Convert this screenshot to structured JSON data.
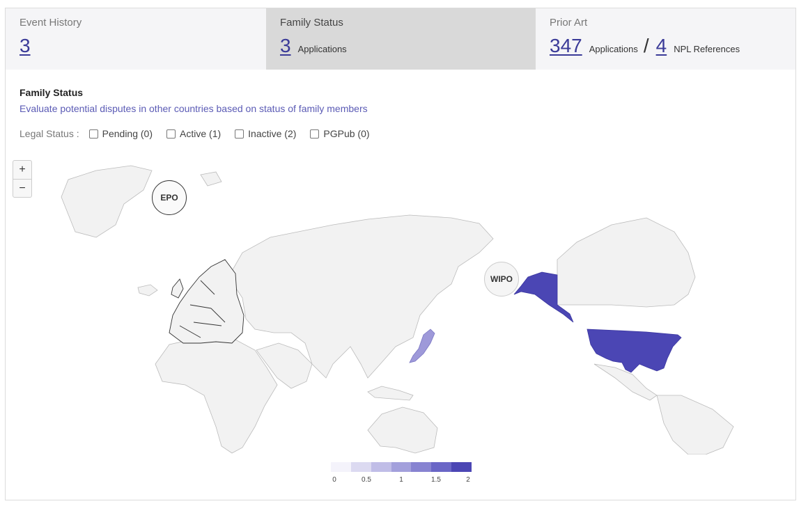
{
  "tabs": [
    {
      "title": "Event History",
      "value": "3",
      "unit": ""
    },
    {
      "title": "Family Status",
      "value": "3",
      "unit": "Applications"
    },
    {
      "title": "Prior Art",
      "value": "347",
      "unit": "Applications",
      "separator": "/",
      "value2": "4",
      "unit2": "NPL References"
    }
  ],
  "section": {
    "title": "Family Status",
    "subtitle": "Evaluate potential disputes in other countries based on status of family members"
  },
  "legal_status": {
    "label": "Legal Status :",
    "options": [
      "Pending (0)",
      "Active (1)",
      "Inactive (2)",
      "PGPub (0)"
    ]
  },
  "zoom": {
    "in": "+",
    "out": "−"
  },
  "map": {
    "bubbles": [
      "EPO",
      "WIPO"
    ],
    "highlighted": [
      {
        "region": "United States",
        "count": 2
      },
      {
        "region": "Japan",
        "count": 1
      }
    ],
    "colors": {
      "land": "#f2f2f2",
      "border": "#bbbbbb",
      "us": "#4b46b4",
      "japan": "#9e99d9",
      "europe_border": "#333333"
    }
  },
  "legend": {
    "ticks": [
      "0",
      "0.5",
      "1",
      "1.5",
      "2"
    ],
    "colors": [
      "#f4f3fb",
      "#dcdaf1",
      "#c0bde7",
      "#a3a0dc",
      "#8783d1",
      "#6a66c6",
      "#4b46b4"
    ]
  }
}
